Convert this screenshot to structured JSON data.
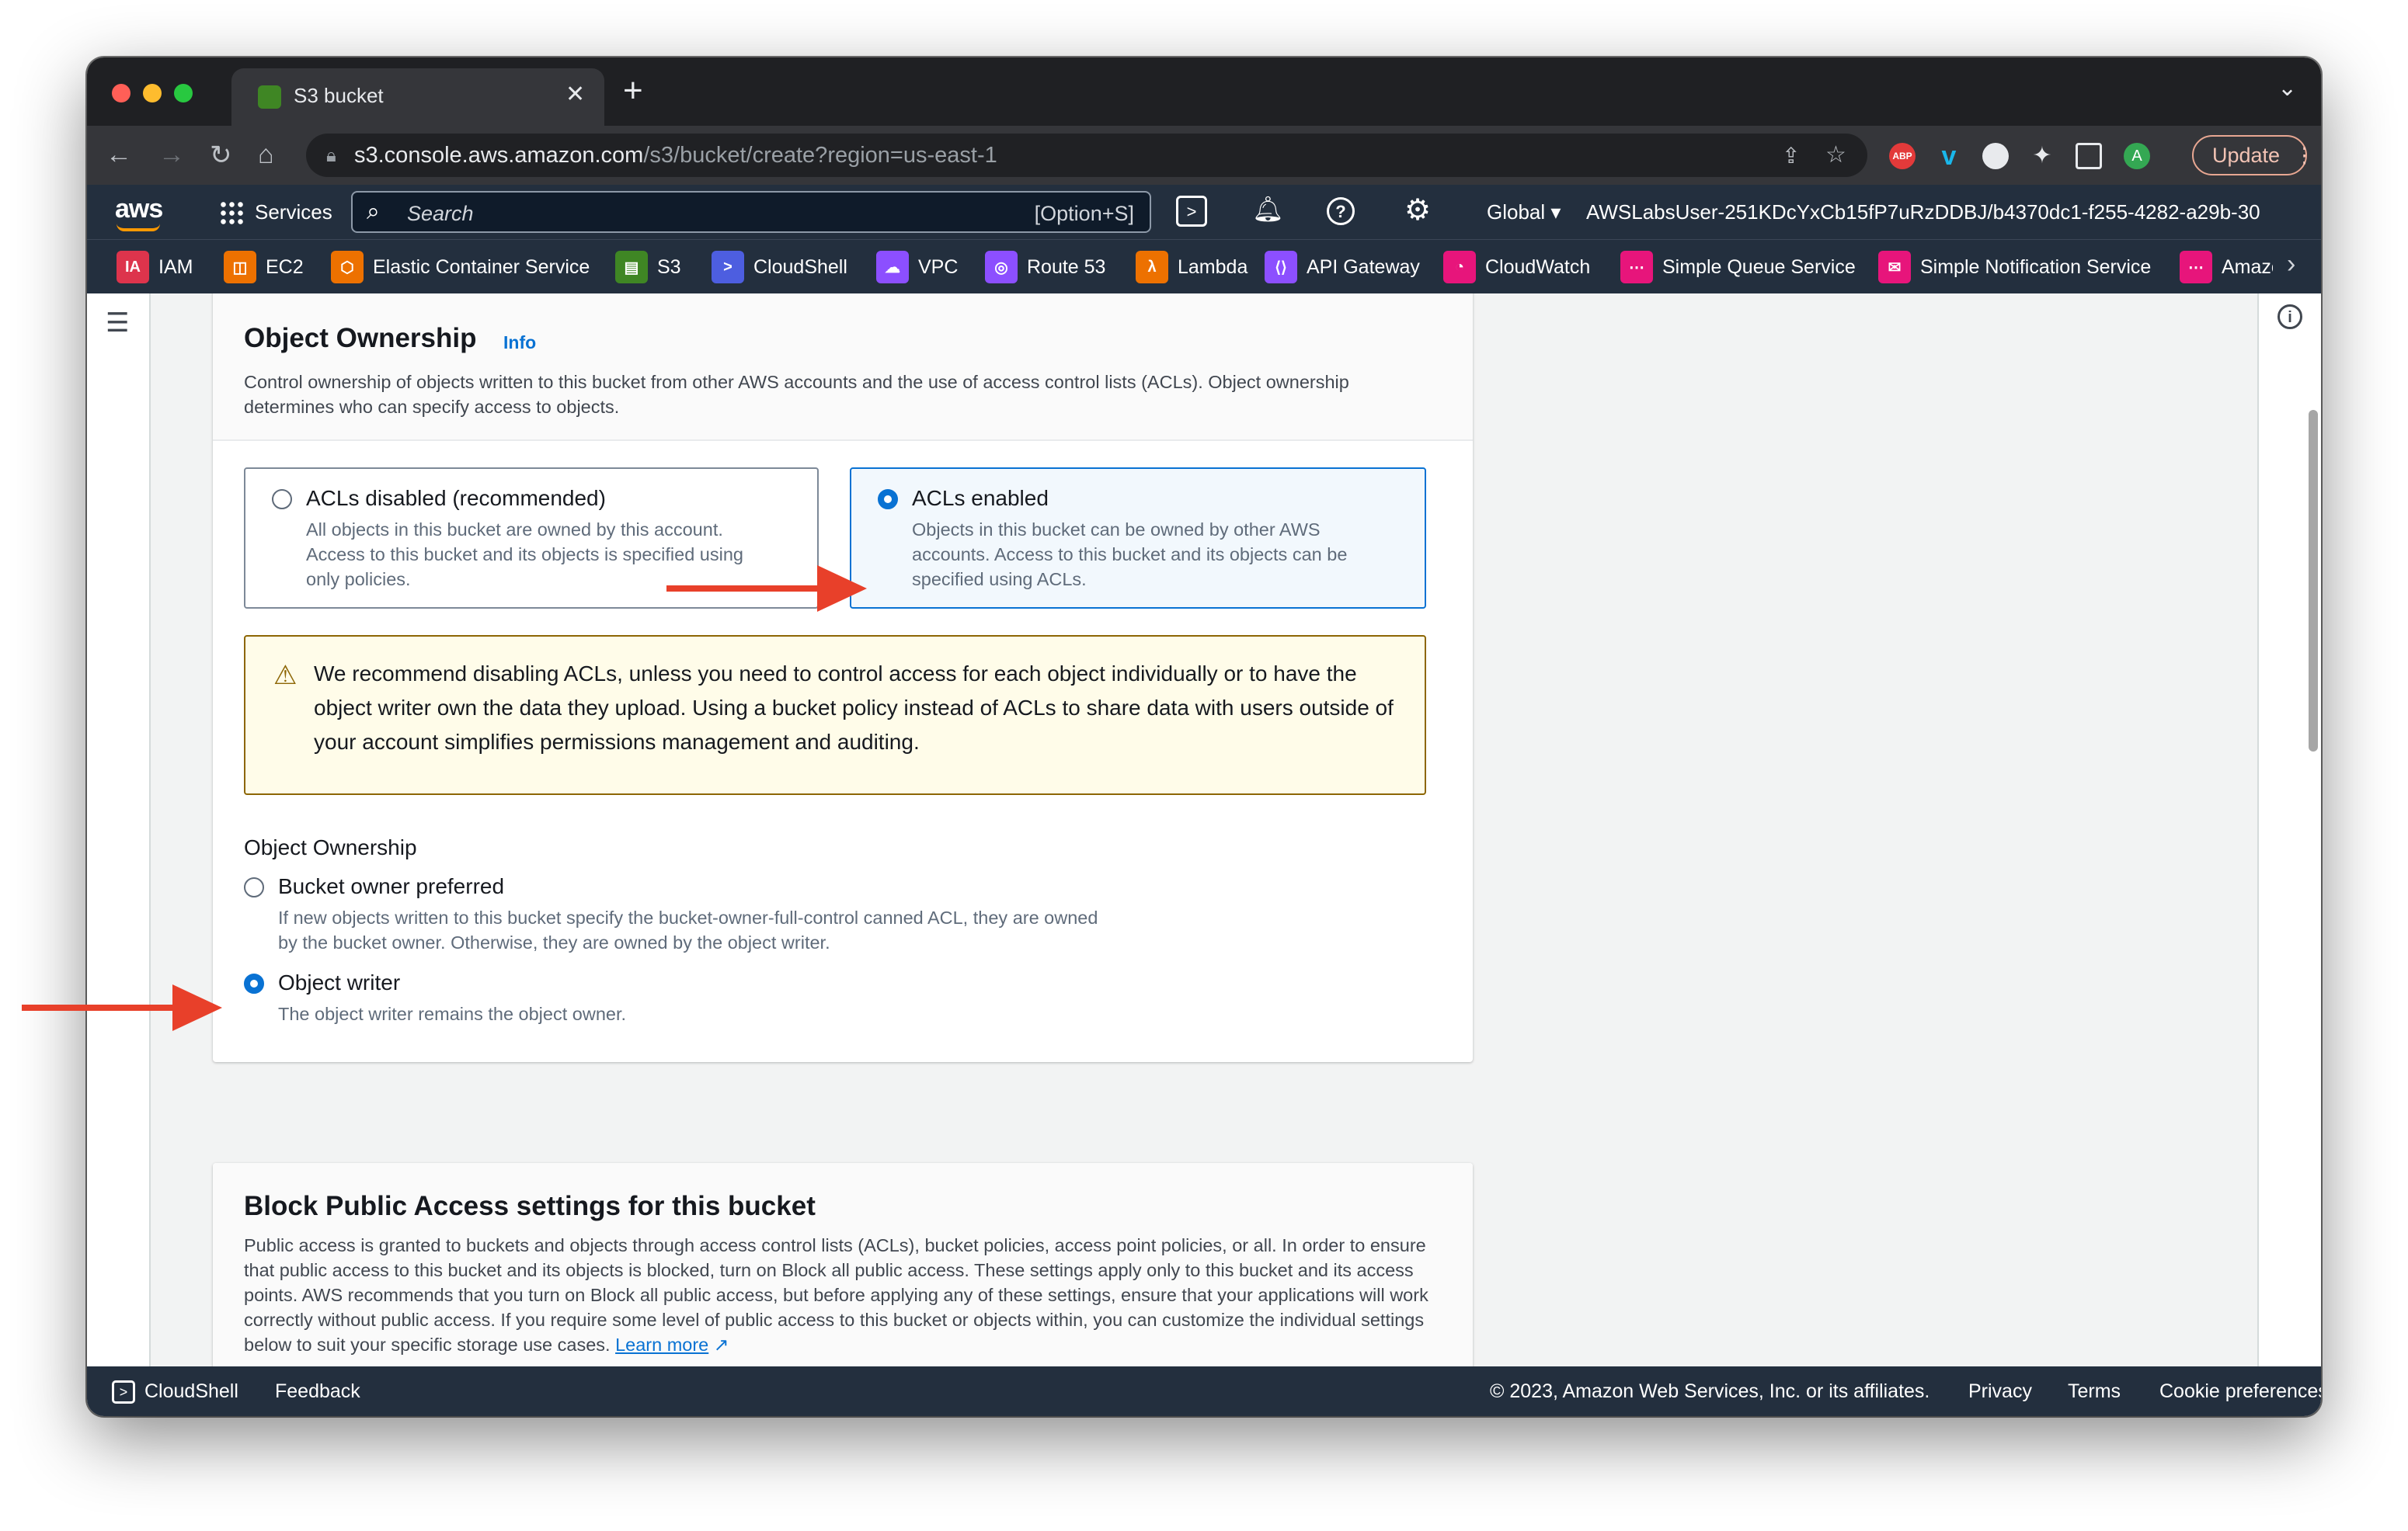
{
  "browser": {
    "tab_title": "S3 bucket",
    "url_host": "s3.console.aws.amazon.com",
    "url_path": "/s3/bucket/create?region=us-east-1",
    "update_label": "Update",
    "profile_initial": "A"
  },
  "aws_header": {
    "services_label": "Services",
    "search_placeholder": "Search",
    "search_shortcut": "[Option+S]",
    "region": "Global",
    "account": "AWSLabsUser-251KDcYxCb15fP7uRzDDBJ/b4370dc1-f255-4282-a29b-30..."
  },
  "favorites": [
    {
      "label": "IAM",
      "color": "#dd344c"
    },
    {
      "label": "EC2",
      "color": "#ed7100"
    },
    {
      "label": "Elastic Container Service",
      "color": "#ed7100"
    },
    {
      "label": "S3",
      "color": "#3f8624"
    },
    {
      "label": "CloudShell",
      "color": "#4d5ee0"
    },
    {
      "label": "VPC",
      "color": "#8c4fff"
    },
    {
      "label": "Route 53",
      "color": "#8c4fff"
    },
    {
      "label": "Lambda",
      "color": "#ed7100"
    },
    {
      "label": "API Gateway",
      "color": "#8c4fff"
    },
    {
      "label": "CloudWatch",
      "color": "#e7157b"
    },
    {
      "label": "Simple Queue Service",
      "color": "#e7157b"
    },
    {
      "label": "Simple Notification Service",
      "color": "#e7157b"
    },
    {
      "label": "Amazo",
      "color": "#e7157b"
    }
  ],
  "object_ownership": {
    "title": "Object Ownership",
    "info": "Info",
    "description": "Control ownership of objects written to this bucket from other AWS accounts and the use of access control lists (ACLs). Object ownership determines who can specify access to objects.",
    "acl_disabled": {
      "label": "ACLs disabled (recommended)",
      "desc": "All objects in this bucket are owned by this account. Access to this bucket and its objects is specified using only policies."
    },
    "acl_enabled": {
      "label": "ACLs enabled",
      "desc": "Objects in this bucket can be owned by other AWS accounts. Access to this bucket and its objects can be specified using ACLs."
    },
    "warning": "We recommend disabling ACLs, unless you need to control access for each object individually or to have the object writer own the data they upload. Using a bucket policy instead of ACLs to share data with users outside of your account simplifies permissions management and auditing.",
    "sub_label": "Object Ownership",
    "bucket_owner_preferred": {
      "label": "Bucket owner preferred",
      "desc": "If new objects written to this bucket specify the bucket-owner-full-control canned ACL, they are owned by the bucket owner. Otherwise, they are owned by the object writer."
    },
    "object_writer": {
      "label": "Object writer",
      "desc": "The object writer remains the object owner."
    },
    "selected_acl": "ACLs enabled",
    "selected_ownership": "Object writer"
  },
  "block_public_access": {
    "title": "Block Public Access settings for this bucket",
    "description": "Public access is granted to buckets and objects through access control lists (ACLs), bucket policies, access point policies, or all. In order to ensure that public access to this bucket and its objects is blocked, turn on Block all public access. These settings apply only to this bucket and its access points. AWS recommends that you turn on Block all public access, but before applying any of these settings, ensure that your applications will work correctly without public access. If you require some level of public access to this bucket or objects within, you can customize the individual settings below to suit your specific storage use cases.",
    "learn_more": "Learn more"
  },
  "footer": {
    "cloudshell": "CloudShell",
    "feedback": "Feedback",
    "copyright": "© 2023, Amazon Web Services, Inc. or its affiliates.",
    "privacy": "Privacy",
    "terms": "Terms",
    "cookie": "Cookie preferences"
  },
  "colors": {
    "annotation_arrow": "#e8402a",
    "selected_radio": "#0972d3",
    "aws_nav": "#232f3e"
  }
}
